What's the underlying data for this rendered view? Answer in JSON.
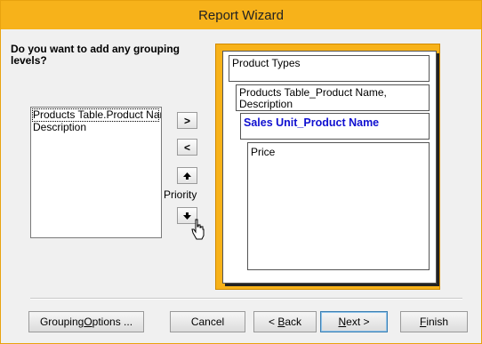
{
  "window": {
    "title": "Report Wizard"
  },
  "question": "Do you want to add any grouping levels?",
  "fields_list": {
    "items": [
      "Products Table.Product Nar",
      "Description"
    ]
  },
  "side_buttons": {
    "add_label": ">",
    "remove_label": "<",
    "priority_label": "Priority"
  },
  "preview": {
    "group_level_1": "Product Types",
    "group_level_2": "Products Table_Product Name, Description",
    "group_level_3": "Sales Unit_Product Name",
    "detail": "Price"
  },
  "footer": {
    "grouping_options": {
      "before": "Grouping ",
      "key": "O",
      "after": "ptions ..."
    },
    "cancel": "Cancel",
    "back": {
      "before": "< ",
      "key": "B",
      "after": "ack"
    },
    "next": {
      "key": "N",
      "after": "ext >"
    },
    "finish": {
      "key": "F",
      "after": "inish"
    }
  },
  "colors": {
    "accent": "#f7b21a",
    "group_highlight_text": "#1010d0"
  }
}
